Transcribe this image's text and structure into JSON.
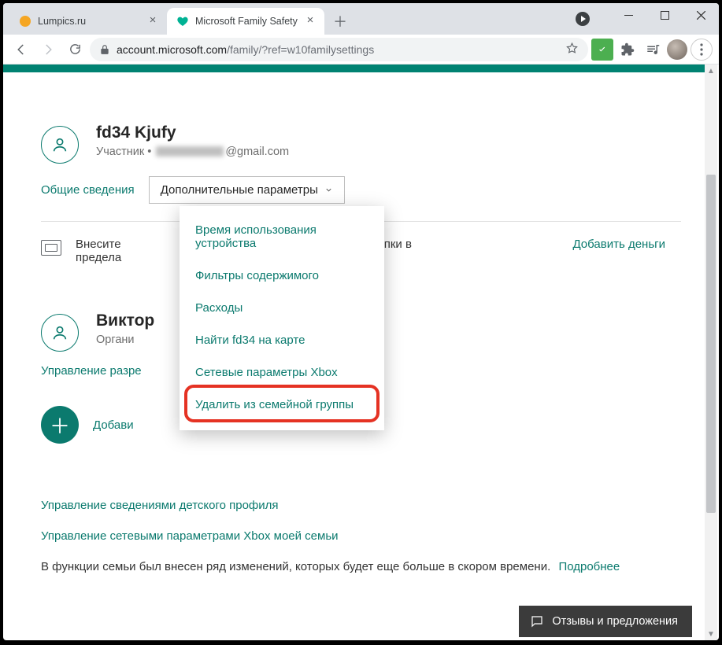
{
  "browser": {
    "tabs": [
      {
        "title": "Lumpics.ru",
        "favicon": "orange-dot"
      },
      {
        "title": "Microsoft Family Safety",
        "favicon": "heart"
      }
    ],
    "url_display": "account.microsoft.com/family/?ref=w10familysettings",
    "url_host": "account.microsoft.com",
    "url_path": "/family/?ref=w10familysettings"
  },
  "member1": {
    "name": "fd34 Kjufy",
    "role_prefix": "Участник  •  ",
    "email_suffix": "@gmail.com"
  },
  "tabs_row": {
    "overview": "Общие сведения",
    "more": "Дополнительные параметры"
  },
  "dropdown": {
    "items": [
      "Время использования устройства",
      "Фильтры содержимого",
      "Расходы",
      "Найти fd34 на карте",
      "Сетевые параметры Xbox",
      "Удалить из семейной группы"
    ]
  },
  "fund": {
    "text_a": "Внесите",
    "text_b": "предела",
    "text_right": "ать покупки в",
    "link": "Добавить деньги"
  },
  "member2": {
    "name_visible": "Виктор",
    "role": "Органи"
  },
  "mgmt_link": "Управление разре",
  "add_member": "Добави",
  "bottom": {
    "child_info": "Управление сведениями детского профиля",
    "xbox_net": "Управление сетевыми параметрами Xbox моей семьи",
    "notice": "В функции семьи был внесен ряд изменений, которых будет еще больше в скором времени.",
    "more": "Подробнее"
  },
  "feedback": "Отзывы и предложения"
}
